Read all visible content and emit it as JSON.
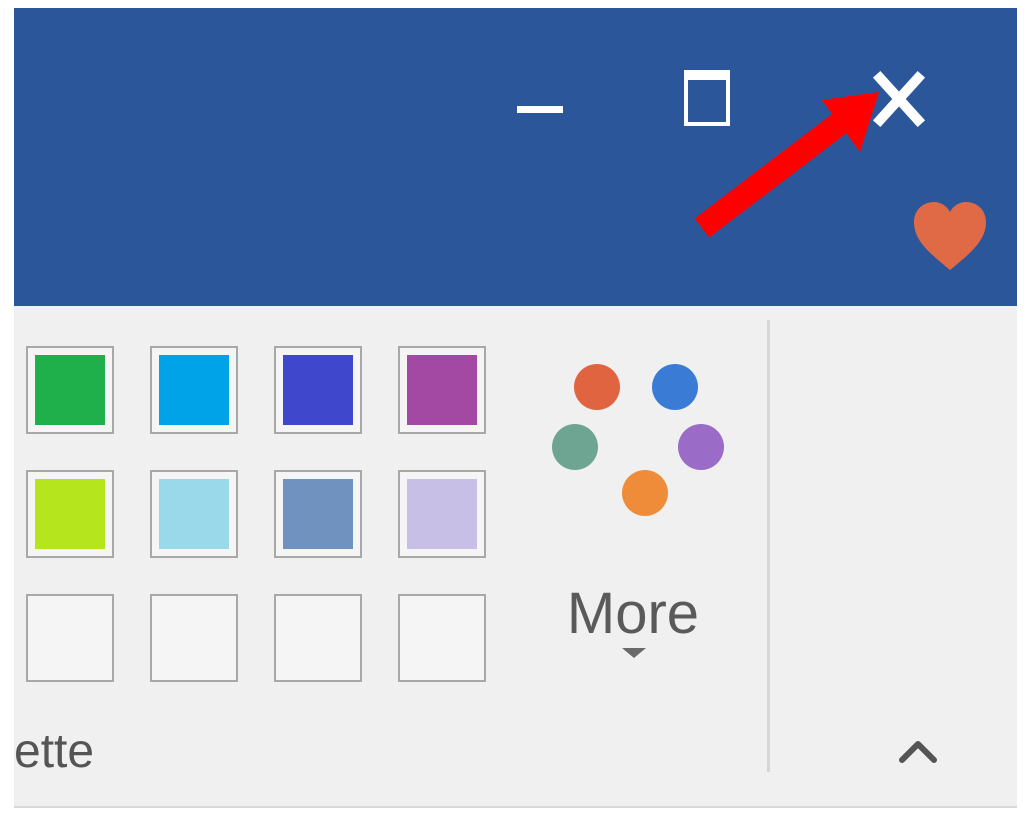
{
  "window": {
    "titlebar_color": "#2b579a",
    "buttons": {
      "minimize": "minimize",
      "maximize": "maximize",
      "close": "close"
    }
  },
  "annotation": {
    "arrow_color": "#ff0000",
    "points_to": "close-button"
  },
  "heart_icon_color": "#e06a45",
  "ribbon": {
    "group_label": "ette",
    "more_label": "More",
    "swatches": [
      [
        "#20b04b",
        "#00a2e8",
        "#3f48cc",
        "#a349a4"
      ],
      [
        "#b5e61d",
        "#99d9ea",
        "#7092be",
        "#c8bfe7"
      ],
      [
        "#f5f5f5",
        "#f5f5f5",
        "#f5f5f5",
        "#f5f5f5"
      ]
    ],
    "more_dot_colors": [
      "#e0643f",
      "#3a7bd5",
      "#6ea592",
      "#9b6bc8",
      "#ef8c3a"
    ]
  }
}
